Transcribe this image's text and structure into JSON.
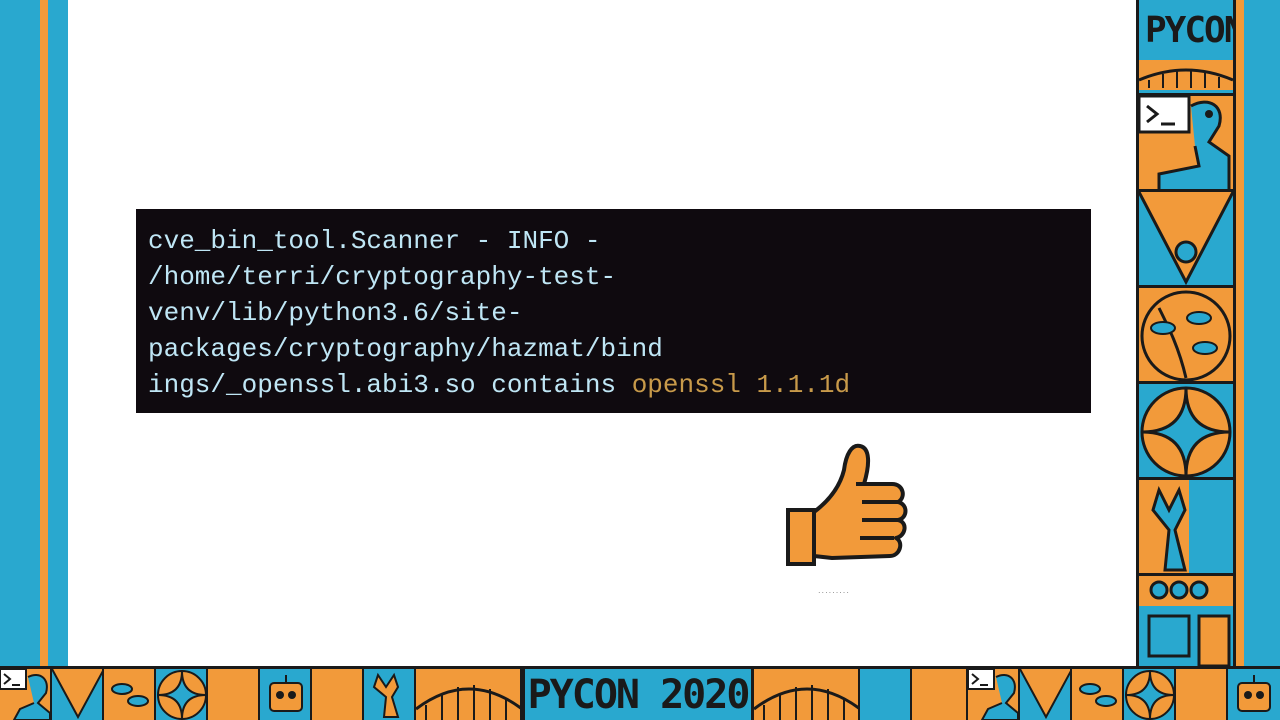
{
  "terminal": {
    "lines": [
      "cve_bin_tool.Scanner - INFO -",
      "/home/terri/cryptography-test-",
      "venv/lib/python3.6/site-",
      "packages/cryptography/hazmat/bind",
      "ings/_openssl.abi3.so contains "
    ],
    "highlight": "openssl 1.1.1d"
  },
  "branding": {
    "side_logo": "PYCON",
    "bottom_title": "PYCON 2020"
  },
  "thumbs_caption": ".........",
  "colors": {
    "frame_blue": "#29a8cf",
    "frame_orange": "#f29a3a",
    "terminal_bg": "#0f0a0f",
    "terminal_text": "#bfe6f5",
    "terminal_highlight": "#c89a4a"
  },
  "icons": [
    "thumbs-up-icon",
    "terminal-prompt-icon",
    "python-snake-icon",
    "laurel-icon",
    "robot-icon",
    "wrench-icon",
    "bridge-icon"
  ]
}
